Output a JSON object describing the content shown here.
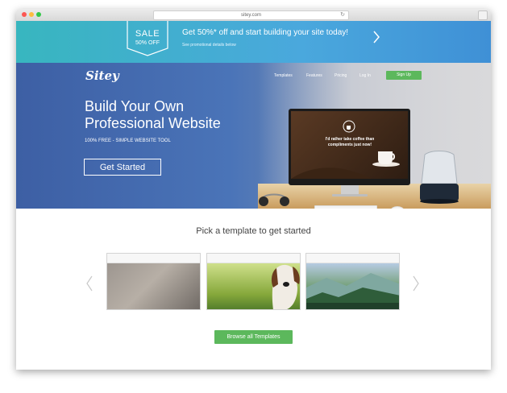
{
  "browser": {
    "url": "sitey.com",
    "reload_glyph": "↻"
  },
  "promo": {
    "badge_line1": "SALE",
    "badge_line2": "50% OFF",
    "title": "Get 50%* off and start building your site today!",
    "note": "See promotional details below"
  },
  "header": {
    "logo": "Sitey",
    "nav": [
      "Templates",
      "Features",
      "Pricing",
      "Log In"
    ],
    "signup": "Sign Up"
  },
  "hero": {
    "title": "Build Your Own Professional Website",
    "subtitle": "100% FREE - SIMPLE WEBSITE TOOL",
    "cta": "Get Started",
    "screen_text": "I'd rather take coffee than compliments just now!"
  },
  "templates": {
    "title": "Pick a template to get started",
    "browse_label": "Browse all Templates"
  },
  "colors": {
    "accent_green": "#5cb85c",
    "promo_teal": "#38b6bf",
    "hero_blue": "#3d5fa4"
  },
  "icons": {
    "prev": "chevron-left-icon",
    "next": "chevron-right-icon",
    "promo_next": "chevron-right-icon",
    "lock": "lock-icon"
  }
}
